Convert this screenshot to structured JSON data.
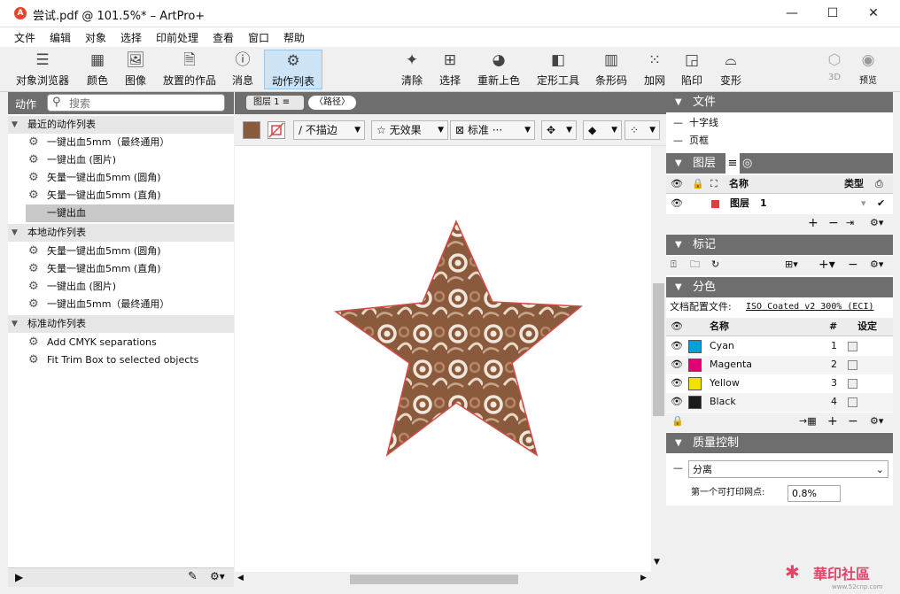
{
  "window": {
    "title": "尝试.pdf @ 101.5%* – ArtPro+",
    "app_icon": "artpro-icon",
    "minimize": "—",
    "maximize": "☐",
    "close": "✕"
  },
  "menu": [
    "文件",
    "编辑",
    "对象",
    "选择",
    "印前处理",
    "查看",
    "窗口",
    "帮助"
  ],
  "toolbar": {
    "left": [
      {
        "label": "对象浏览器",
        "icon": "object-browser-icon"
      },
      {
        "label": "颜色",
        "icon": "color-grid-icon"
      },
      {
        "label": "图像",
        "icon": "image-icon"
      },
      {
        "label": "放置的作品",
        "icon": "placed-art-icon"
      },
      {
        "label": "消息",
        "icon": "info-icon"
      },
      {
        "label": "动作列表",
        "icon": "gears-icon",
        "active": true
      }
    ],
    "right": [
      {
        "label": "清除",
        "icon": "sparkle-icon"
      },
      {
        "label": "选择",
        "icon": "select-frame-icon"
      },
      {
        "label": "重新上色",
        "icon": "recolor-icon"
      },
      {
        "label": "定形工具",
        "icon": "shape-tool-icon"
      },
      {
        "label": "条形码",
        "icon": "barcode-icon"
      },
      {
        "label": "加网",
        "icon": "screening-icon"
      },
      {
        "label": "陷印",
        "icon": "trap-icon"
      },
      {
        "label": "变形",
        "icon": "distort-icon"
      }
    ],
    "disabled": [
      {
        "label": "3D",
        "icon": "cube-icon"
      },
      {
        "label": "预览",
        "icon": "preview-warning-icon"
      }
    ]
  },
  "actions_panel": {
    "title": "动作",
    "search_placeholder": "搜索",
    "groups": [
      {
        "name": "最近的动作列表",
        "items": [
          "一键出血5mm（最终通用）",
          "一键出血 (图片)",
          "矢量一键出血5mm (圆角)",
          "矢量一键出血5mm (直角)",
          "一键出血"
        ]
      },
      {
        "name": "本地动作列表",
        "items": [
          "矢量一键出血5mm (圆角)",
          "矢量一键出血5mm (直角)",
          "一键出血 (图片)",
          "一键出血5mm（最终通用）"
        ]
      },
      {
        "name": "标准动作列表",
        "items": [
          "Add CMYK separations",
          "Fit Trim Box to selected objects"
        ]
      }
    ],
    "selected": "一键出血"
  },
  "center": {
    "layer_pill": "图层 1",
    "path_pill": "〈路径〉",
    "stroke_dropdown": "不描边",
    "effect_dropdown": "无效果",
    "blend_dropdown": "标准",
    "blend_more": "···"
  },
  "file_panel": {
    "title": "文件",
    "items": [
      "十字线",
      "页框"
    ]
  },
  "layers_panel": {
    "title": "图层",
    "columns": {
      "name": "名称",
      "type": "类型"
    },
    "rows": [
      {
        "name": "图层",
        "number": "1"
      }
    ]
  },
  "marks_panel": {
    "title": "标记"
  },
  "separations_panel": {
    "title": "分色",
    "profile_label": "文档配置文件:",
    "profile_value": "ISO Coated v2 300% (ECI)",
    "columns": {
      "name": "名称",
      "num": "#",
      "setting": "设定"
    },
    "rows": [
      {
        "name": "Cyan",
        "num": "1",
        "color": "#00a0d8"
      },
      {
        "name": "Magenta",
        "num": "2",
        "color": "#e0007a"
      },
      {
        "name": "Yellow",
        "num": "3",
        "color": "#f5e000"
      },
      {
        "name": "Black",
        "num": "4",
        "color": "#1a1a1a"
      }
    ]
  },
  "qc_panel": {
    "title": "质量控制",
    "mode_value": "分离",
    "dot_label": "第一个可打印网点:",
    "dot_value": "0.8%"
  },
  "watermark": {
    "text": "華印社區",
    "url": "www.52cnp.com"
  },
  "colors": {
    "panel_header": "#6e6e6e",
    "active_tool": "#cde4f7",
    "star_outline": "#d34a45",
    "star_fill": "#8a5a3c"
  }
}
